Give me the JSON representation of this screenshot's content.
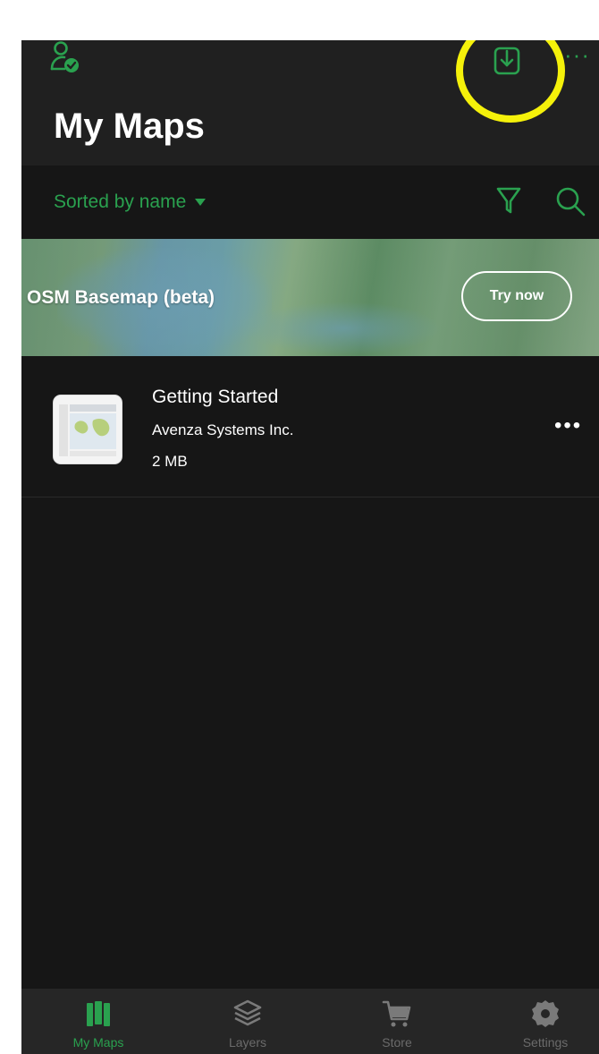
{
  "header": {
    "title": "My Maps",
    "more_label": "···",
    "icons": {
      "account": "account-verified-icon",
      "import": "import-map-icon"
    }
  },
  "sort": {
    "label": "Sorted by name",
    "icons": {
      "filter": "filter-icon",
      "search": "search-icon"
    }
  },
  "banner": {
    "title": "OSM Basemap (beta)",
    "button_label": "Try now"
  },
  "maps": [
    {
      "name": "Getting Started",
      "author": "Avenza Systems Inc.",
      "size": "2 MB",
      "more_label": "•••"
    }
  ],
  "tabs": [
    {
      "label": "My Maps",
      "icon": "map-icon",
      "active": true
    },
    {
      "label": "Layers",
      "icon": "layers-icon",
      "active": false
    },
    {
      "label": "Store",
      "icon": "cart-icon",
      "active": false
    },
    {
      "label": "Settings",
      "icon": "gear-icon",
      "active": false
    }
  ],
  "colors": {
    "accent": "#2aa14f",
    "background": "#161616",
    "header": "#202020",
    "tabbar": "#262626",
    "highlight": "#f5f10a"
  }
}
